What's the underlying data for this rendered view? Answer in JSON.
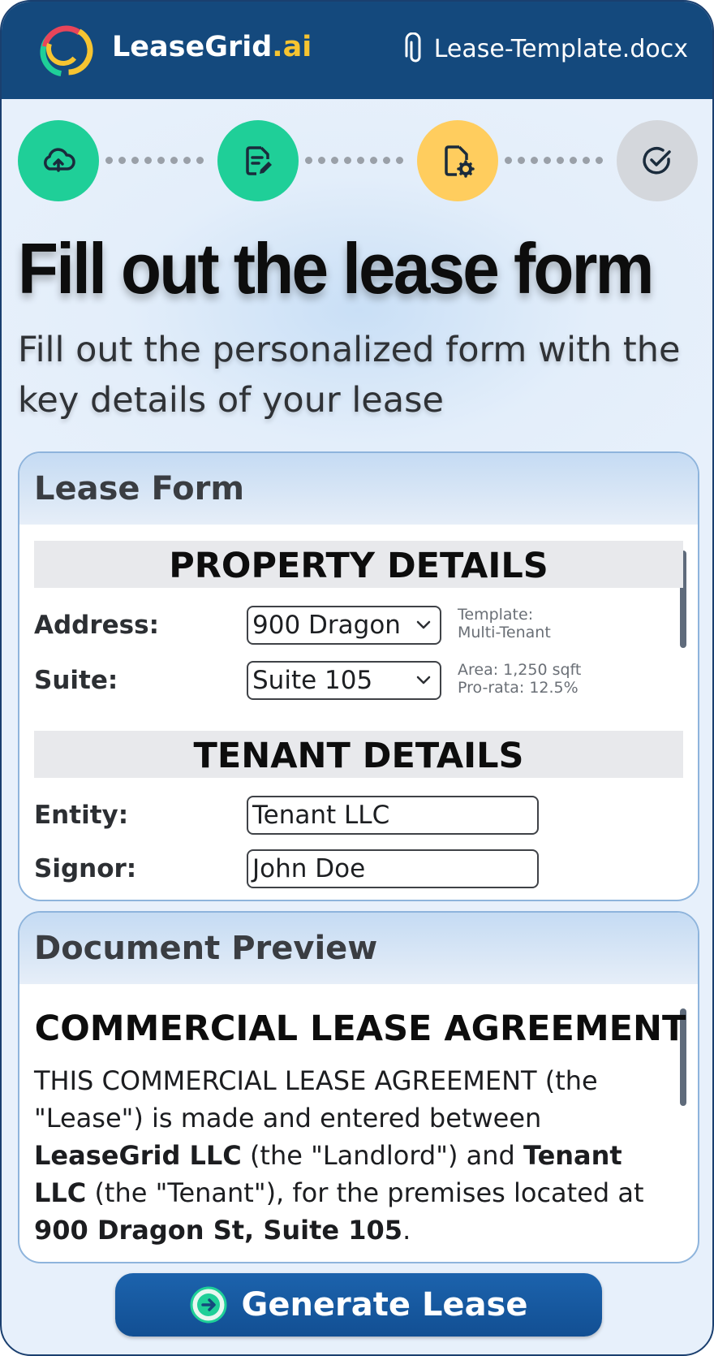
{
  "app": {
    "brand_name": "LeaseGrid",
    "brand_tld": ".ai",
    "file_name": "Lease-Template.docx"
  },
  "stepper": {
    "steps": [
      {
        "icon": "cloud-upload-icon",
        "state": "complete",
        "color": "#1fcf98"
      },
      {
        "icon": "document-edit-icon",
        "state": "complete",
        "color": "#1fcf98"
      },
      {
        "icon": "document-settings-icon",
        "state": "active",
        "color": "#ffcd5e"
      },
      {
        "icon": "check-circle-icon",
        "state": "pending",
        "color": "#d4d7dc"
      }
    ]
  },
  "page": {
    "title": "Fill out the lease form",
    "subtitle": "Fill out the personalized form with the key details of your lease"
  },
  "form": {
    "card_title": "Lease Form",
    "property_section": "PROPERTY DETAILS",
    "address_label": "Address:",
    "address_value": "900 Dragon",
    "address_meta_1": "Template:",
    "address_meta_2": "Multi-Tenant",
    "suite_label": "Suite:",
    "suite_value": "Suite 105",
    "suite_meta_1": "Area: 1,250 sqft",
    "suite_meta_2": "Pro-rata: 12.5%",
    "tenant_section": "TENANT DETAILS",
    "entity_label": "Entity:",
    "entity_value": "Tenant LLC",
    "signor_label": "Signor:",
    "signor_value": "John Doe"
  },
  "preview": {
    "card_title": "Document Preview",
    "doc_title": "COMMERCIAL LEASE AGREEMENT",
    "t1": "THIS COMMERCIAL LEASE AGREEMENT (the \"Lease\") is made and entered between ",
    "landlord": "LeaseGrid LLC",
    "t2": " (the \"Landlord\") and ",
    "tenant": "Tenant LLC",
    "t3": " (the \"Tenant\"), for the premises located at ",
    "premises": "900 Dragon St, Suite 105",
    "t4": "."
  },
  "actions": {
    "generate_label": "Generate Lease"
  },
  "colors": {
    "header": "#14497d",
    "accent_gold": "#f6c431",
    "step_done": "#1fcf98",
    "step_active": "#ffcd5e",
    "button": "#1c63ad"
  }
}
